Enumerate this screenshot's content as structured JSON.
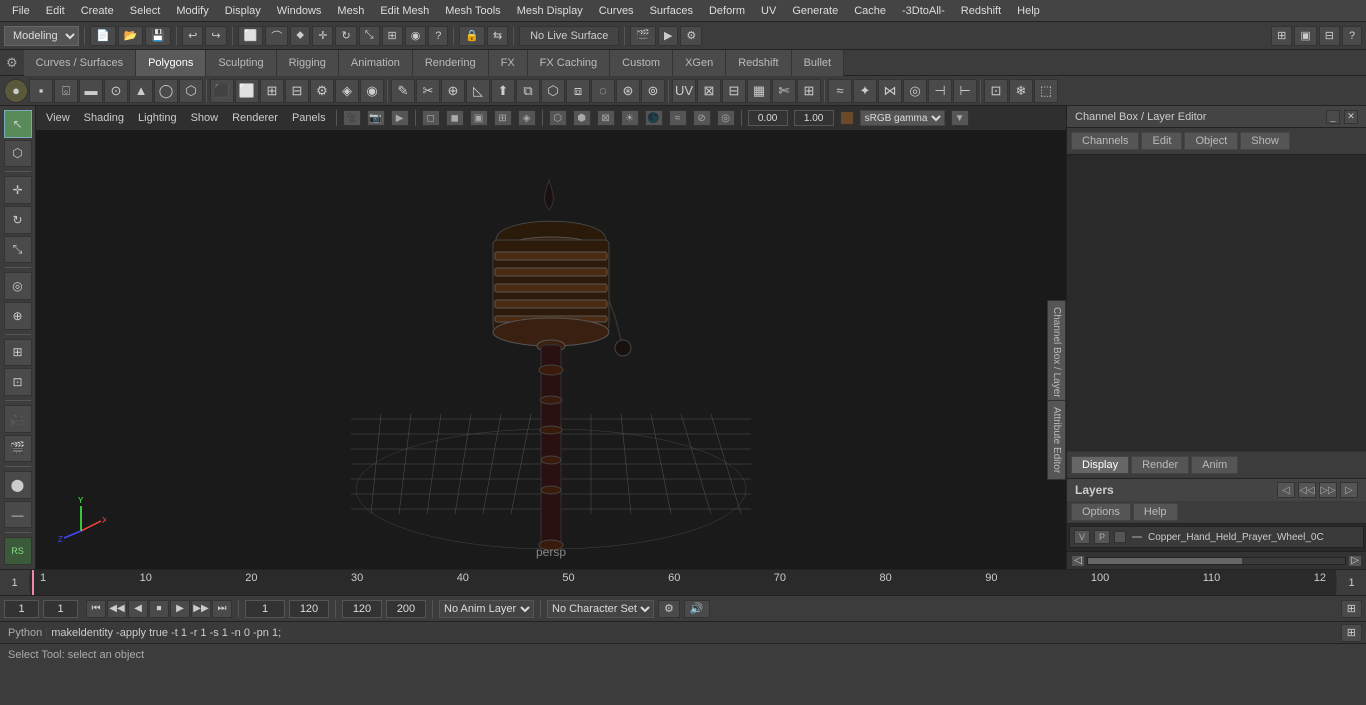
{
  "menu": {
    "items": [
      "File",
      "Edit",
      "Create",
      "Select",
      "Modify",
      "Display",
      "Windows",
      "Mesh",
      "Edit Mesh",
      "Mesh Tools",
      "Mesh Display",
      "Curves",
      "Surfaces",
      "Deform",
      "UV",
      "Generate",
      "Cache",
      "-3DtoAll-",
      "Redshift",
      "Help"
    ]
  },
  "toolbar1": {
    "workspace_dropdown": "Modeling",
    "live_surface_btn": "No Live Surface"
  },
  "tabs": {
    "items": [
      "Curves / Surfaces",
      "Polygons",
      "Sculpting",
      "Rigging",
      "Animation",
      "Rendering",
      "FX",
      "FX Caching",
      "Custom",
      "XGen",
      "Redshift",
      "Bullet"
    ]
  },
  "active_tab": "Polygons",
  "viewport": {
    "view_menu": "View",
    "shading_menu": "Shading",
    "lighting_menu": "Lighting",
    "show_menu": "Show",
    "renderer_menu": "Renderer",
    "panels_menu": "Panels",
    "value1": "0.00",
    "value2": "1.00",
    "color_space": "sRGB gamma",
    "camera": "persp"
  },
  "right_panel": {
    "title": "Channel Box / Layer Editor",
    "tabs": [
      "Channels",
      "Edit",
      "Object",
      "Show"
    ],
    "display_tab": "Display",
    "render_tab": "Render",
    "anim_tab": "Anim",
    "layer_title": "Layers",
    "layer_sub_tabs": [
      "Options",
      "Help"
    ],
    "layer_row": {
      "vp_btn1": "V",
      "vp_btn2": "P",
      "layer_name": "Copper_Hand_Held_Prayer_Wheel_0C"
    },
    "side_label1": "Channel Box / Layer Editor",
    "side_label2": "Attribute Editor"
  },
  "timeline": {
    "left_num": "1",
    "right_num": "1",
    "ticks": [
      "1",
      "10",
      "20",
      "30",
      "40",
      "50",
      "60",
      "70",
      "80",
      "90",
      "100",
      "110",
      "12"
    ]
  },
  "playback": {
    "frame_start": "1",
    "frame_end": "120",
    "anim_end": "120",
    "range_end": "200",
    "anim_layer": "No Anim Layer",
    "char_set": "No Character Set"
  },
  "command_bar": {
    "label": "Python",
    "text": "makeldentity -apply true -t 1 -r 1 -s 1 -n 0 -pn 1;"
  },
  "status_bar": {
    "text": "Select Tool: select an object"
  },
  "frame_fields": {
    "f1": "1",
    "f2": "1"
  },
  "icons": {
    "new": "📄",
    "open": "📂",
    "save": "💾",
    "undo": "↩",
    "redo": "↪",
    "select": "↖",
    "move": "✛",
    "rotate": "↻",
    "scale": "⤡",
    "snap": "📌",
    "play_start": "⏮",
    "play_prev": "◀◀",
    "play_back": "◀",
    "play_stop": "⏹",
    "play_fwd": "▶",
    "play_next": "▶▶",
    "play_end": "⏭",
    "key_prev": "◄",
    "key_next": "►"
  }
}
